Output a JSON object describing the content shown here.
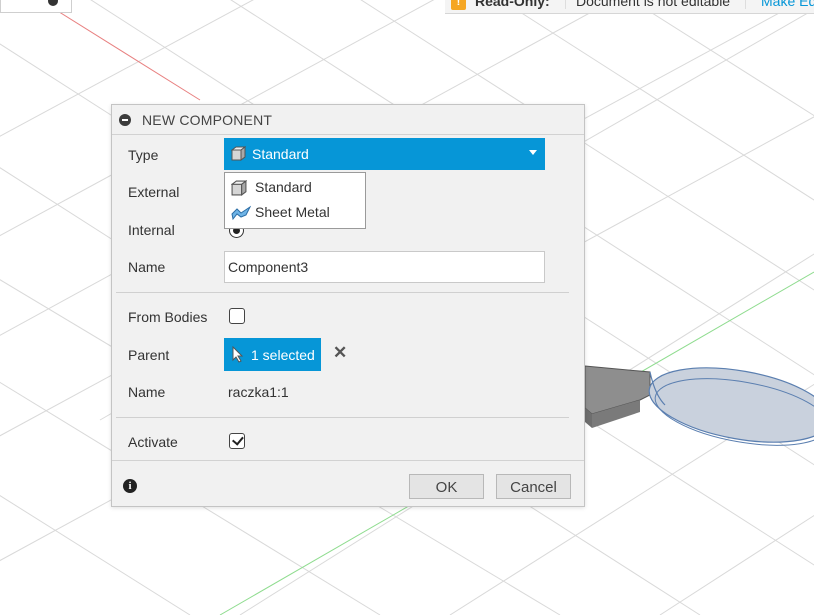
{
  "topbar": {
    "readonly_title": "Read-Only:",
    "readonly_message": "Document is not editable",
    "make_editable_link": "Make Ed"
  },
  "dialog": {
    "title": "NEW COMPONENT",
    "type": {
      "label": "Type",
      "selected": "Standard",
      "options": [
        "Standard",
        "Sheet Metal"
      ]
    },
    "external": {
      "label": "External",
      "selected": false
    },
    "internal": {
      "label": "Internal",
      "selected": true
    },
    "name": {
      "label": "Name",
      "value": "Component3"
    },
    "from_bodies": {
      "label": "From Bodies",
      "checked": false
    },
    "parent": {
      "label": "Parent",
      "selection": "1 selected"
    },
    "parent_name": {
      "label": "Name",
      "value": "raczka1:1"
    },
    "activate": {
      "label": "Activate",
      "checked": true
    },
    "ok_label": "OK",
    "cancel_label": "Cancel"
  },
  "colors": {
    "accent": "#0696d7",
    "warning": "#f5a623",
    "grid": "#d8d8d8",
    "axis_x": "#e88080",
    "axis_z": "#7ed67e",
    "model_fill": "#c8d2e0",
    "model_stroke": "#5b7fb0"
  }
}
